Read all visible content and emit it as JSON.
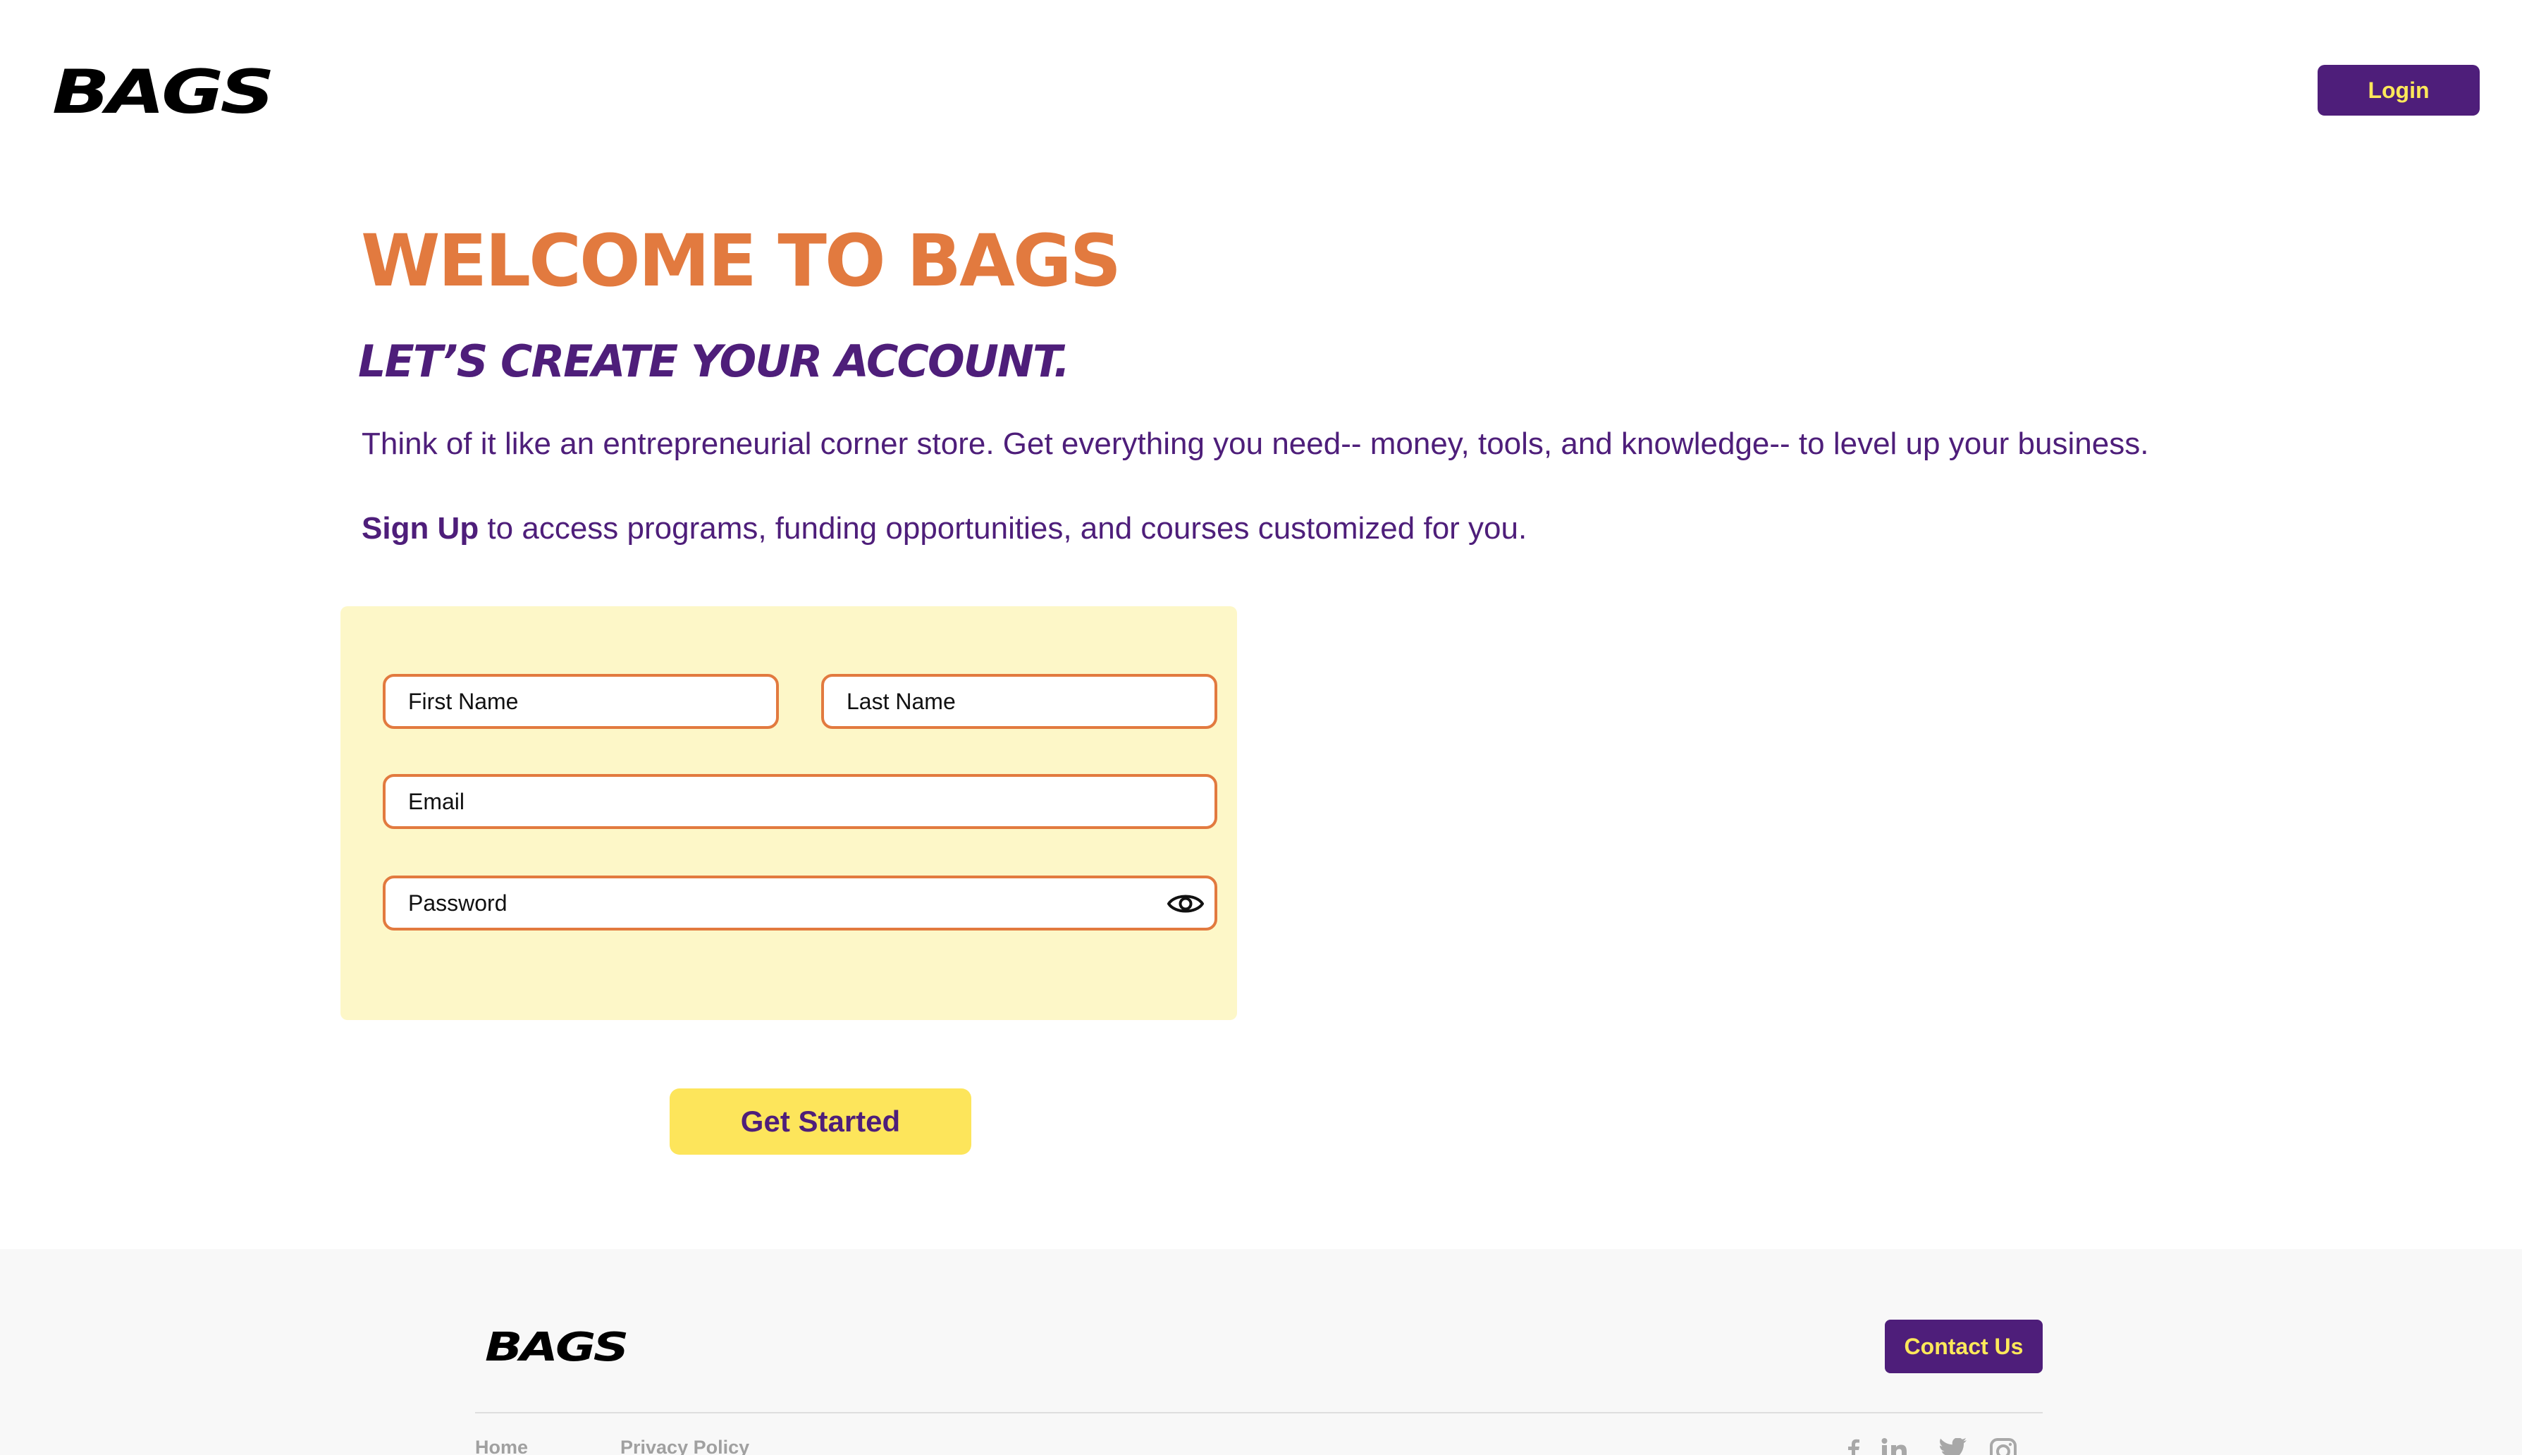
{
  "header": {
    "logo_text": "BAGS",
    "login_label": "Login"
  },
  "hero": {
    "title": "WELCOME TO BAGS",
    "subtitle": "LET’S CREATE YOUR ACCOUNT.",
    "intro": "Think of it like an entrepreneurial corner store. Get everything you need-- money, tools, and knowledge-- to level up your business.",
    "signup_strong": "Sign Up",
    "signup_rest": " to access programs, funding opportunities, and courses customized for you."
  },
  "form": {
    "first_name_placeholder": "First Name",
    "last_name_placeholder": "Last Name",
    "email_placeholder": "Email",
    "password_placeholder": "Password",
    "password_toggle_icon": "eye-icon",
    "submit_label": "Get Started"
  },
  "footer": {
    "logo_text": "BAGS",
    "contact_label": "Contact Us",
    "links": [
      "Home",
      "Privacy Policy"
    ],
    "social_icons": [
      "facebook-icon",
      "linkedin-icon",
      "twitter-icon",
      "instagram-icon"
    ]
  },
  "colors": {
    "brand_purple": "#4e1e7a",
    "brand_orange": "#e27a3f",
    "brand_yellow": "#fde55b",
    "form_background": "#fdf7c8",
    "footer_background": "#f8f8f8"
  }
}
